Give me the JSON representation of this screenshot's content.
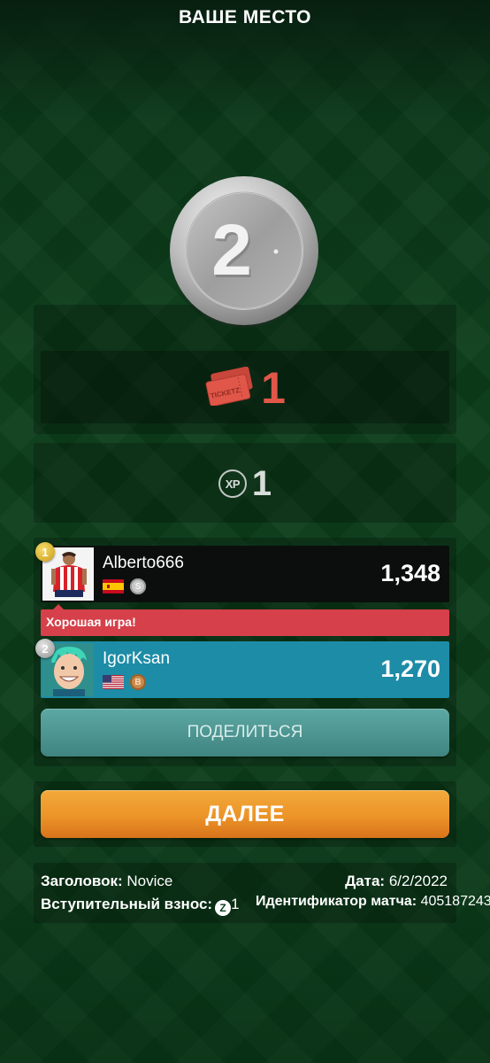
{
  "header": {
    "title": "ВАШЕ МЕСТО"
  },
  "medal": {
    "place": "2",
    "color": "silver"
  },
  "rewards": {
    "tickets_label": "TICKETZ",
    "tickets_value": "1",
    "xp_label": "XP",
    "xp_value": "1"
  },
  "leaderboard": {
    "players": [
      {
        "place": "1",
        "name": "Alberto666",
        "country": "Spain",
        "level_badge": "silver",
        "score": "1,348"
      },
      {
        "place": "2",
        "name": "IgorKsan",
        "country": "USA",
        "level_badge": "bronze",
        "score": "1,270"
      }
    ],
    "chat_message": "Хорошая игра!"
  },
  "buttons": {
    "share_label": "ПОДЕЛИТЬСЯ",
    "next_label": "ДАЛЕЕ"
  },
  "match_info": {
    "title_label": "Заголовок:",
    "title_value": "Novice",
    "date_label": "Дата:",
    "date_value": "6/2/2022",
    "fee_label": "Вступительный взнос:",
    "fee_currency": "Z",
    "fee_value": "1",
    "match_id_label": "Идентификатор матча:",
    "match_id_value": "405187243"
  },
  "colors": {
    "background": "#0b3d1a",
    "ticket_red": "#e0574a",
    "player2_row": "#1d8ca6",
    "chat_bubble": "#d6404a",
    "share_button": "#4f9894",
    "next_button": "#ec9428"
  }
}
